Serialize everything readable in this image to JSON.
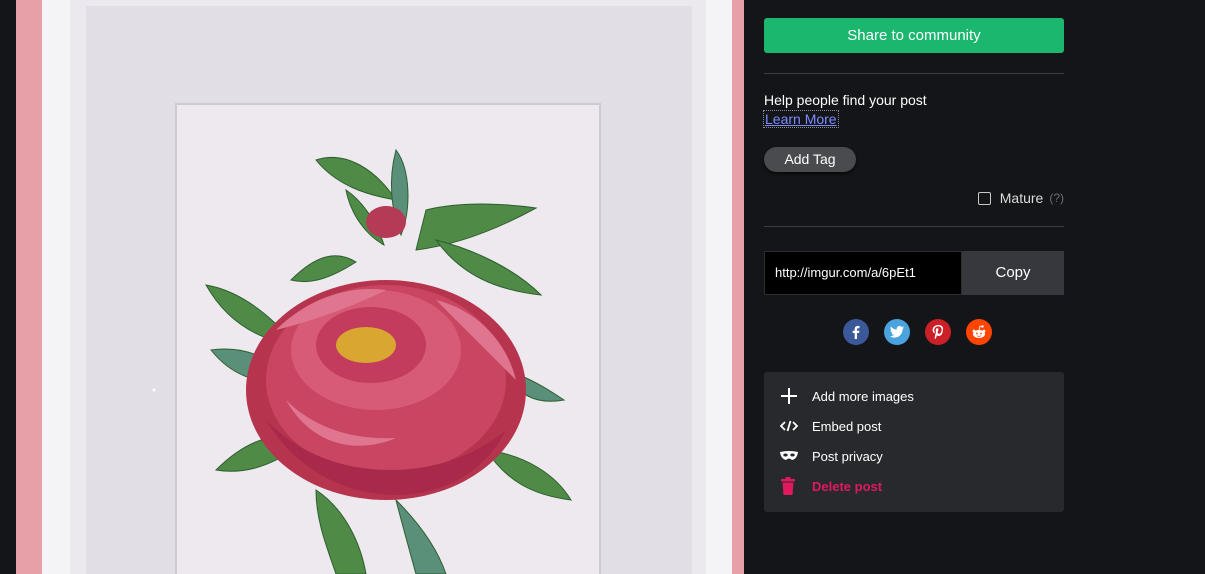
{
  "image": {
    "alt": ""
  },
  "share": {
    "label": "Share to community",
    "color": "#1bb76e"
  },
  "help": {
    "text": "Help people find your post",
    "learn_more": "Learn More"
  },
  "tags": {
    "add_label": "Add Tag"
  },
  "mature": {
    "label": "Mature",
    "hint": "(?)",
    "checked": false
  },
  "link": {
    "url": "http://imgur.com/a/6pEt1",
    "copy_label": "Copy"
  },
  "socials": [
    {
      "name": "facebook",
      "color": "#3b5998",
      "glyph": "f"
    },
    {
      "name": "twitter",
      "color": "#4aa3df",
      "glyph": "t"
    },
    {
      "name": "pinterest",
      "color": "#cb2027",
      "glyph": "p"
    },
    {
      "name": "reddit",
      "color": "#ff4500",
      "glyph": "r"
    }
  ],
  "actions": {
    "add_images": "Add more images",
    "embed": "Embed post",
    "privacy": "Post privacy",
    "delete": "Delete post"
  },
  "colors": {
    "background": "#141518",
    "danger": "#e0195f",
    "link": "#7c8cff"
  }
}
